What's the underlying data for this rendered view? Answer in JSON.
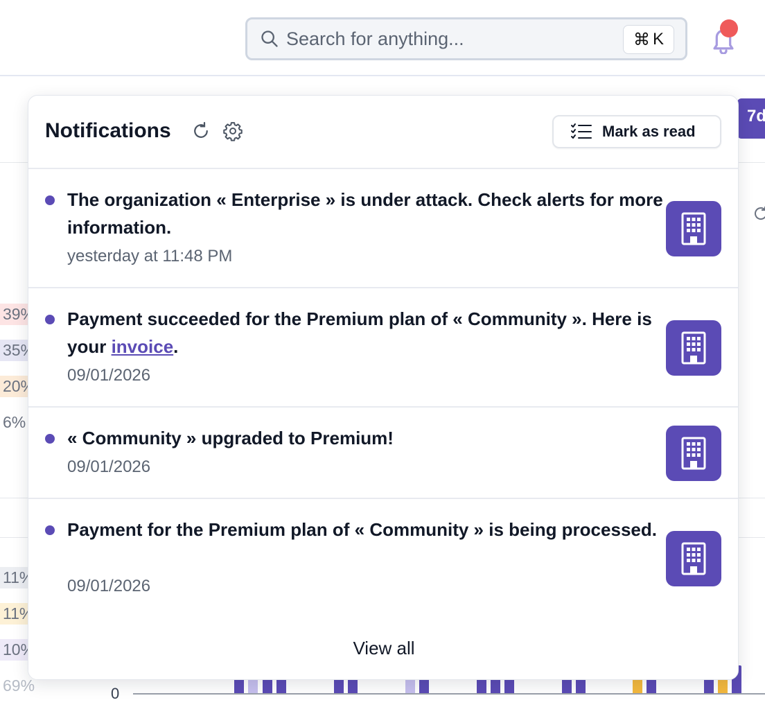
{
  "header": {
    "search_placeholder": "Search for anything...",
    "shortcut_symbol": "⌘",
    "shortcut_key": "K"
  },
  "background": {
    "period_label": "7d",
    "percentages": [
      "39%",
      "35%",
      "20%",
      "6%",
      "11%",
      "11%",
      "10%",
      "69%"
    ],
    "axis_zero": "0"
  },
  "notifications": {
    "title": "Notifications",
    "mark_as_read": "Mark as read",
    "view_all": "View all",
    "items": [
      {
        "message": "The organization « Enterprise » is under attack. Check alerts for more information.",
        "time": "yesterday at 11:48 PM"
      },
      {
        "message_before": "Payment succeeded for the Premium plan of « Community ». Here is your ",
        "link_text": "invoice",
        "message_after": ".",
        "time": "09/01/2026"
      },
      {
        "message": "« Community » upgraded to Premium!",
        "time": "09/01/2026"
      },
      {
        "message": "Payment for the Premium plan of « Community » is being processed.",
        "time": "09/01/2026"
      }
    ]
  },
  "colors": {
    "accent": "#5b4bb5",
    "alert_dot": "#ef5a5a"
  }
}
